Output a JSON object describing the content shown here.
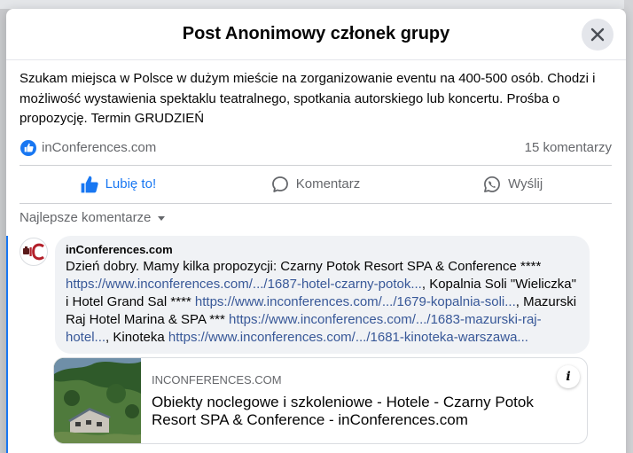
{
  "modal": {
    "title": "Post Anonimowy członek grupy"
  },
  "post": {
    "text": "Szukam miejsca w Polsce w dużym mieście na zorganizowanie eventu na 400-500 osób. Chodzi i możliwość wystawienia spektaklu teatralnego, spotkania autorskiego lub koncertu. Prośba o propozycję. Termin GRUDZIEŃ",
    "reactor": "inConferences.com",
    "comment_count": "15 komentarzy"
  },
  "actions": {
    "like": "Lubię to!",
    "comment": "Komentarz",
    "share": "Wyślij"
  },
  "sort": {
    "label": "Najlepsze komentarze"
  },
  "comment": {
    "author": "inConferences.com",
    "t1": "Dzień dobry. Mamy kilka propozycji: Czarny Potok Resort SPA & Conference **** ",
    "link1": "https://www.inconferences.com/.../1687-hotel-czarny-potok...",
    "t2": ", Kopalnia Soli \"Wieliczka\" i Hotel Grand Sal **** ",
    "link2": "https://www.inconferences.com/.../1679-kopalnia-soli...",
    "t3": ", Mazurski Raj Hotel Marina & SPA *** ",
    "link3": "https://www.inconferences.com/.../1683-mazurski-raj-hotel...",
    "t4": ", Kinoteka ",
    "link4": "https://www.inconferences.com/.../1681-kinoteka-warszawa..."
  },
  "link_card": {
    "domain": "INCONFERENCES.COM",
    "title": "Obiekty noclegowe i szkoleniowe - Hotele - Czarny Potok Resort SPA & Conference - inConferences.com"
  },
  "colors": {
    "accent": "#1877f2",
    "link": "#385898",
    "muted": "#65676b",
    "bubble": "#f0f2f5"
  }
}
